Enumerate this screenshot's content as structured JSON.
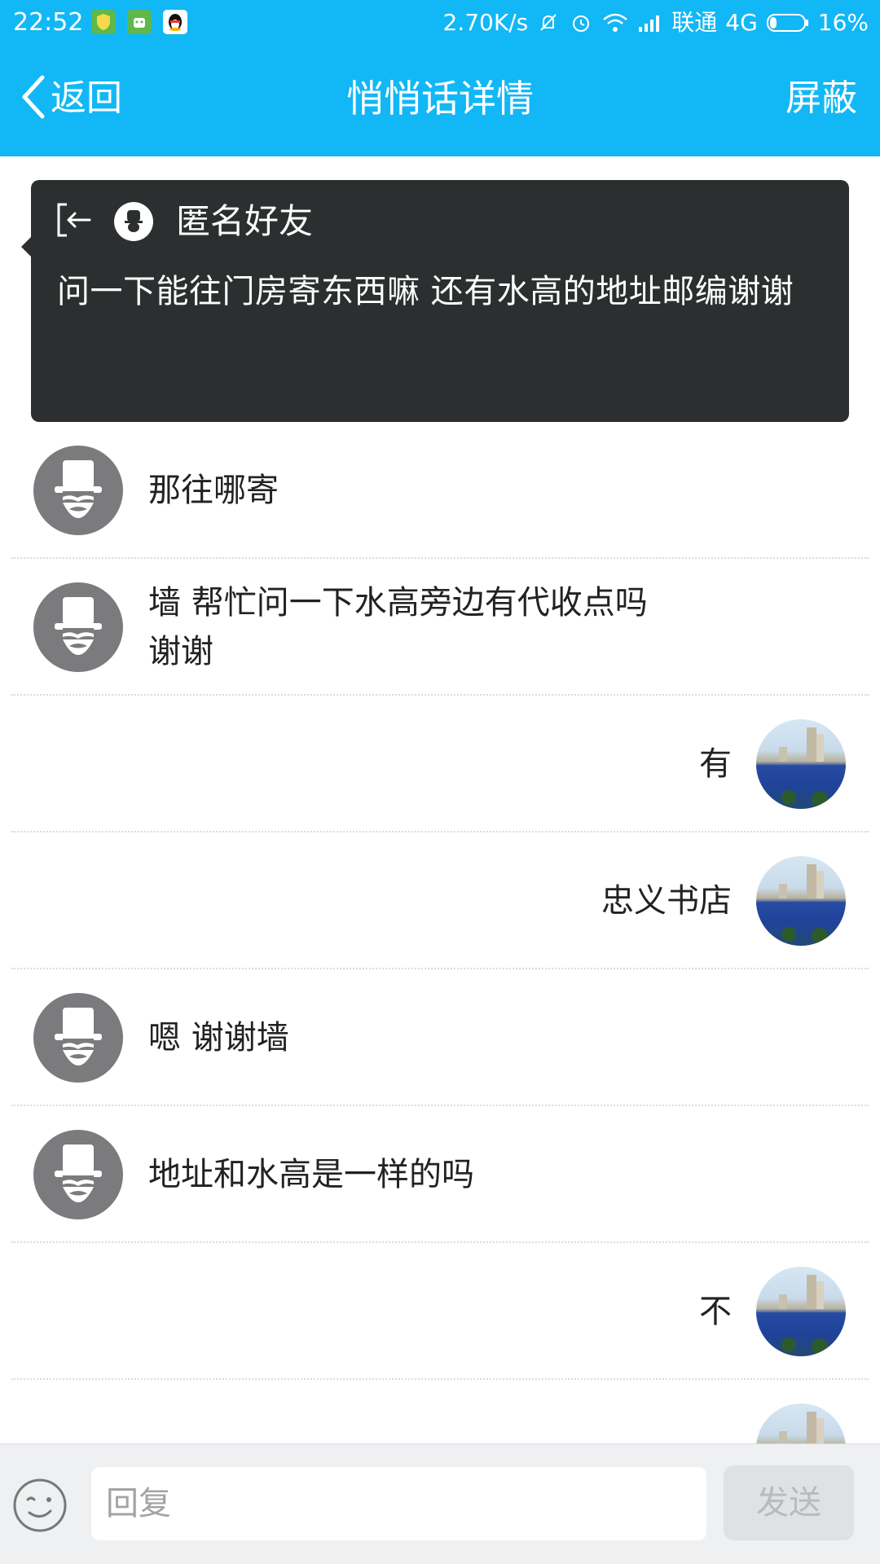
{
  "status_bar": {
    "time": "22:52",
    "network_speed": "2.70K/s",
    "carrier": "联通",
    "network_type": "4G",
    "battery": "16%",
    "notification_icons": [
      "shield-icon",
      "android-icon",
      "qq-penguin-icon"
    ],
    "indicator_icons": [
      "mute-bell-icon",
      "alarm-icon",
      "wifi-icon",
      "signal-icon",
      "battery-icon"
    ]
  },
  "nav": {
    "back_label": "返回",
    "title": "悄悄话详情",
    "block_label": "屏蔽"
  },
  "original_message": {
    "sender": "匿名好友",
    "text": "问一下能往门房寄东西嘛 还有水高的地址邮编谢谢"
  },
  "messages": [
    {
      "side": "left",
      "avatar": "anonymous-avatar",
      "text": "那往哪寄"
    },
    {
      "side": "left",
      "avatar": "anonymous-avatar",
      "text": "墙 帮忙问一下水高旁边有代收点吗 谢谢"
    },
    {
      "side": "right",
      "avatar": "user-photo-avatar",
      "text": "有"
    },
    {
      "side": "right",
      "avatar": "user-photo-avatar",
      "text": "忠义书店"
    },
    {
      "side": "left",
      "avatar": "anonymous-avatar",
      "text": "嗯 谢谢墙"
    },
    {
      "side": "left",
      "avatar": "anonymous-avatar",
      "text": "地址和水高是一样的吗"
    },
    {
      "side": "right",
      "avatar": "user-photo-avatar",
      "text": "不"
    },
    {
      "side": "right",
      "avatar": "user-photo-avatar",
      "text": ""
    }
  ],
  "input_bar": {
    "placeholder": "回复",
    "send_label": "发送",
    "emoji_icon": "emoji-smile-icon"
  },
  "colors": {
    "header": "#12b7f5",
    "card_background": "#2c2f2f",
    "anon_avatar": "#7b7b7d",
    "input_bar": "#eef0f2",
    "send_disabled": "#dfe1e3"
  }
}
